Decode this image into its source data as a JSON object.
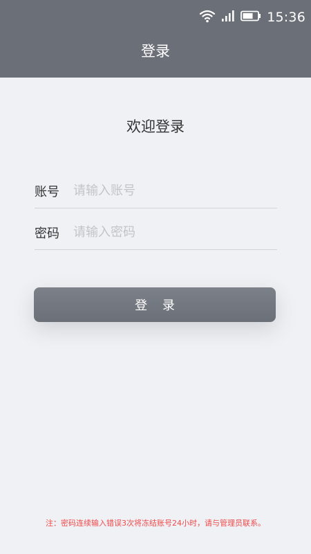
{
  "status_bar": {
    "time": "15:36",
    "icons": [
      "wifi-icon",
      "signal-icon",
      "battery-icon"
    ]
  },
  "header": {
    "title": "登录"
  },
  "main": {
    "welcome": "欢迎登录",
    "account": {
      "label": "账号",
      "placeholder": "请输入账号",
      "value": ""
    },
    "password": {
      "label": "密码",
      "placeholder": "请输入密码",
      "value": ""
    },
    "login_button": "登 录",
    "notice": "注：密码连续输入错误3次将冻结账号24小时，请与管理员联系。"
  },
  "colors": {
    "header": "#6b6f78",
    "background": "#f0f1f5",
    "button": "#6b6f78",
    "notice": "#f04a4a"
  }
}
